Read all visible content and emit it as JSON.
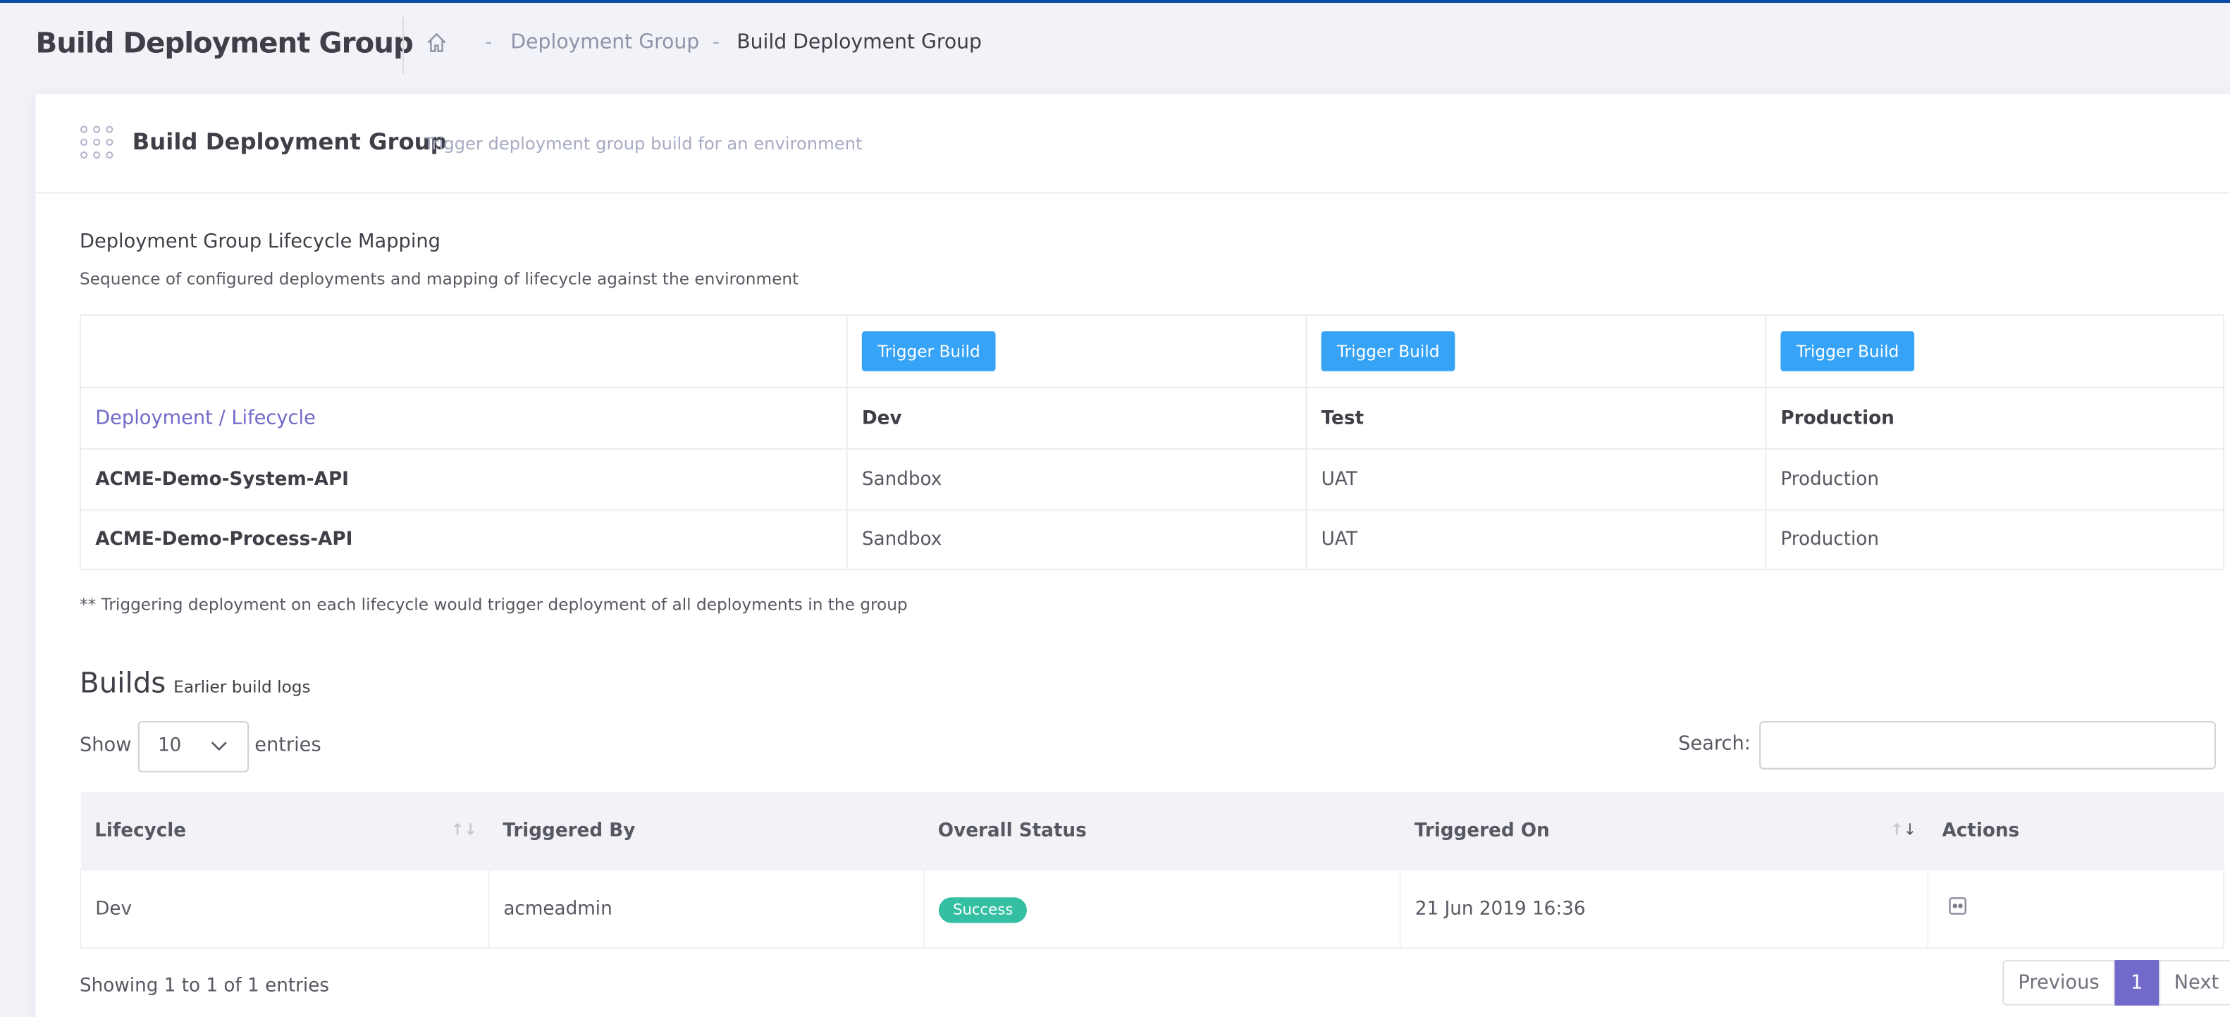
{
  "header": {
    "title": "Build Deployment Group",
    "breadcrumb": [
      "Deployment Group",
      "Build Deployment Group"
    ],
    "separator": "-"
  },
  "card": {
    "title": "Build Deployment Group",
    "subtitle": "Trigger deployment group build for an environment"
  },
  "mapping": {
    "title": "Deployment Group Lifecycle Mapping",
    "description": "Sequence of configured deployments and mapping of lifecycle against the environment",
    "trigger_label": "Trigger Build",
    "header_label": "Deployment / Lifecycle",
    "environments": [
      "Dev",
      "Test",
      "Production"
    ],
    "rows": [
      {
        "deployment": "ACME-Demo-System-API",
        "values": [
          "Sandbox",
          "UAT",
          "Production"
        ]
      },
      {
        "deployment": "ACME-Demo-Process-API",
        "values": [
          "Sandbox",
          "UAT",
          "Production"
        ]
      }
    ],
    "note": "** Triggering deployment on each lifecycle would trigger deployment of all deployments in the group"
  },
  "builds": {
    "title": "Builds",
    "subtitle": "Earlier build logs",
    "show": "Show",
    "entries_value": "10",
    "entries": "entries",
    "search_label": "Search:",
    "search_value": "",
    "columns": [
      "Lifecycle",
      "Triggered By",
      "Overall Status",
      "Triggered On",
      "Actions"
    ],
    "rows": [
      {
        "lifecycle": "Dev",
        "triggered_by": "acmeadmin",
        "status": "Success",
        "triggered_on": "21 Jun 2019 16:36"
      }
    ],
    "info": "Showing 1 to 1 of 1 entries",
    "pagination": {
      "previous": "Previous",
      "page": "1",
      "next": "Next"
    }
  },
  "colors": {
    "accent": "#716aca",
    "button": "#36a3f7",
    "success": "#34bfa3",
    "topbar": "#0b4aa6"
  }
}
